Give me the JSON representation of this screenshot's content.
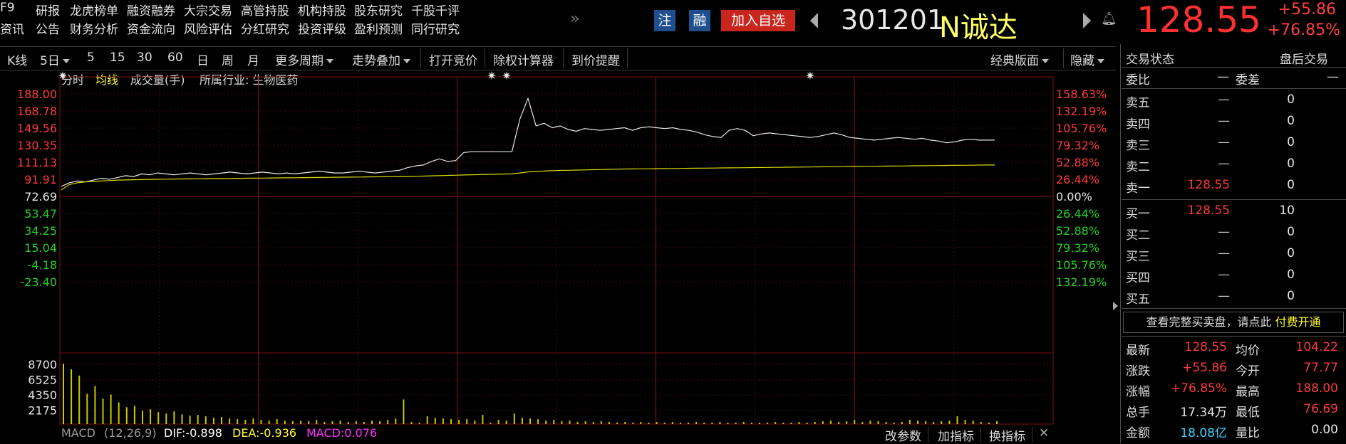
{
  "nav": {
    "row1": [
      "F9",
      "研报",
      "龙虎榜单",
      "融资融券",
      "大宗交易",
      "高管持股",
      "机构持股",
      "股东研究",
      "千股千评"
    ],
    "row2": [
      "资讯",
      "公告",
      "财务分析",
      "资金流向",
      "风险评估",
      "分红研究",
      "投资评级",
      "盈利预测",
      "同行研究"
    ],
    "more": "»"
  },
  "header": {
    "badge_zhu": "注",
    "badge_rong": "融",
    "add_watch": "加入自选",
    "code": "301201",
    "name": "N诚达",
    "price": "128.55",
    "change": "+55.86",
    "change_pct": "+76.85%"
  },
  "toolbar": {
    "kline": "K线",
    "period": "5日",
    "items": [
      "5",
      "15",
      "30",
      "60",
      "日",
      "周",
      "月"
    ],
    "more_period": "更多周期",
    "overlay": "走势叠加",
    "auction": "打开竞价",
    "calc": "除权计算器",
    "alert": "到价提醒",
    "layout": "经典版面",
    "hide": "隐藏"
  },
  "chart_tabs": [
    "分时",
    "均线",
    "成交量(手)",
    "所属行业: 生物医药"
  ],
  "chart_data": {
    "type": "line",
    "price_axis": [
      "188.00",
      "168.78",
      "149.56",
      "130.35",
      "111.13",
      "91.91",
      "72.69",
      "53.47",
      "34.25",
      "15.04",
      "-4.18",
      "-23.40"
    ],
    "pct_axis": [
      "158.63%",
      "132.19%",
      "105.76%",
      "79.32%",
      "52.88%",
      "26.44%",
      "0.00%",
      "26.44%",
      "52.88%",
      "79.32%",
      "105.76%",
      "132.19%"
    ],
    "ylim": [
      -23.4,
      188.0
    ],
    "prev_close": 72.69,
    "volume_axis": [
      "8700",
      "6525",
      "4350",
      "2175"
    ],
    "volume_max": 8700,
    "series": [
      {
        "values": [
          84,
          88,
          90,
          89,
          91,
          93,
          92,
          94,
          96,
          95,
          98,
          97,
          99,
          98,
          97,
          98,
          99,
          98,
          97,
          98,
          99,
          100,
          99,
          98,
          99,
          100,
          99,
          98,
          99,
          98,
          99,
          100,
          101,
          100,
          99,
          99,
          100,
          101,
          100,
          99,
          100,
          101,
          102,
          105,
          107,
          108,
          112,
          115,
          112,
          113,
          122,
          123,
          123,
          123,
          123,
          123,
          123,
          160,
          183,
          152,
          155,
          150,
          152,
          148,
          146,
          149,
          148,
          147,
          148,
          149,
          150,
          147,
          150,
          151,
          150,
          149,
          150,
          148,
          147,
          145,
          142,
          140,
          139,
          147,
          149,
          147,
          141,
          143,
          144,
          143,
          142,
          141,
          140,
          139,
          140,
          142,
          144,
          142,
          139,
          138,
          137,
          136,
          137,
          138,
          139,
          138,
          137,
          138,
          136,
          135,
          133,
          134,
          136,
          137,
          136,
          136,
          136
        ]
      },
      {
        "values": [
          80,
          86,
          88,
          89,
          89.5,
          90,
          90.5,
          91,
          91.2,
          91.4,
          91.6,
          91.8,
          92,
          92.1,
          92.2,
          92.3,
          92.4,
          92.5,
          92.6,
          92.7,
          92.8,
          92.9,
          93,
          93.1,
          93.2,
          93.3,
          93.4,
          93.5,
          93.6,
          93.7,
          93.8,
          93.9,
          94,
          94.1,
          94.2,
          94.3,
          94.4,
          94.5,
          94.6,
          94.7,
          94.8,
          94.9,
          95,
          95.1,
          95.3,
          95.5,
          95.8,
          96,
          96.3,
          96.5,
          96.8,
          97,
          97.2,
          97.4,
          97.6,
          97.8,
          98,
          99,
          100.2,
          100.8,
          101.2,
          101.6,
          101.9,
          102.1,
          102.3,
          102.5,
          102.7,
          102.9,
          103.1,
          103.3,
          103.5,
          103.6,
          103.7,
          103.8,
          103.9,
          104,
          104.1,
          104.2,
          104.3,
          104.4,
          104.5,
          104.6,
          104.7,
          104.8,
          104.9,
          105,
          105.1,
          105.2,
          105.3,
          105.4,
          105.5,
          105.6,
          105.7,
          105.8,
          105.9,
          106,
          106.1,
          106.2,
          106.3,
          106.4,
          106.5,
          106.6,
          106.7,
          106.8,
          106.9,
          107,
          107.1,
          107.2,
          107.3,
          107.4,
          107.5,
          107.6,
          107.7,
          107.8,
          107.9,
          108,
          108
        ]
      }
    ],
    "volume": [
      8600,
      7800,
      6900,
      4300,
      5400,
      3600,
      4200,
      3100,
      2400,
      2600,
      1900,
      2100,
      1700,
      1500,
      1800,
      1400,
      1200,
      1300,
      1100,
      900,
      1000,
      800,
      700,
      600,
      800,
      600,
      500,
      700,
      500,
      400,
      500,
      400,
      600,
      300,
      400,
      500,
      300,
      400,
      300,
      500,
      400,
      600,
      800,
      3500,
      300,
      200,
      1100,
      900,
      800,
      700,
      600,
      700,
      500,
      1300,
      200,
      600,
      500,
      1500,
      900,
      800,
      700,
      500,
      600,
      400,
      500,
      300,
      400,
      300,
      400,
      300,
      200,
      300,
      200,
      300,
      200,
      300,
      200,
      300,
      200,
      200,
      300,
      200,
      200,
      300,
      200,
      200,
      300,
      200,
      200,
      200,
      300,
      200,
      200,
      300,
      200,
      300,
      400,
      500,
      300,
      400,
      600,
      300,
      500,
      400,
      300,
      200,
      300,
      600,
      500,
      400,
      300,
      400,
      500,
      1100,
      600,
      500,
      300,
      200,
      400
    ]
  },
  "indicator": {
    "name": "MACD",
    "params": "(12,26,9)",
    "dif": "DIF:-0.898",
    "dea": "DEA:-0.936",
    "macd": "MACD:0.076",
    "change_params": "改参数",
    "add": "加指标",
    "swap": "换指标",
    "close": "✕"
  },
  "panel": {
    "status_label": "交易状态",
    "status_value": "盘后交易",
    "ratio_label": "委比",
    "ratio_value": "—",
    "diff_label": "委差",
    "diff_value": "—",
    "asks": [
      {
        "label": "卖五",
        "price": "—",
        "vol": "0"
      },
      {
        "label": "卖四",
        "price": "—",
        "vol": "0"
      },
      {
        "label": "卖三",
        "price": "—",
        "vol": "0"
      },
      {
        "label": "卖二",
        "price": "—",
        "vol": "0"
      },
      {
        "label": "卖一",
        "price": "128.55",
        "vol": "0"
      }
    ],
    "bids": [
      {
        "label": "买一",
        "price": "128.55",
        "vol": "10"
      },
      {
        "label": "买二",
        "price": "—",
        "vol": "0"
      },
      {
        "label": "买三",
        "price": "—",
        "vol": "0"
      },
      {
        "label": "买四",
        "price": "—",
        "vol": "0"
      },
      {
        "label": "买五",
        "price": "—",
        "vol": "0"
      }
    ],
    "promo_text": "查看完整买卖盘，请点此",
    "promo_link": "付费开通",
    "stats": [
      {
        "l1": "最新",
        "v1": "128.55",
        "l2": "均价",
        "v2": "104.22"
      },
      {
        "l1": "涨跌",
        "v1": "+55.86",
        "l2": "今开",
        "v2": "77.77"
      },
      {
        "l1": "涨幅",
        "v1": "+76.85%",
        "l2": "最高",
        "v2": "188.00"
      },
      {
        "l1": "总手",
        "v1": "17.34万",
        "l2": "最低",
        "v2": "76.69"
      },
      {
        "l1": "金额",
        "v1": "18.08亿",
        "l2": "量比",
        "v2": "0.00"
      }
    ]
  }
}
